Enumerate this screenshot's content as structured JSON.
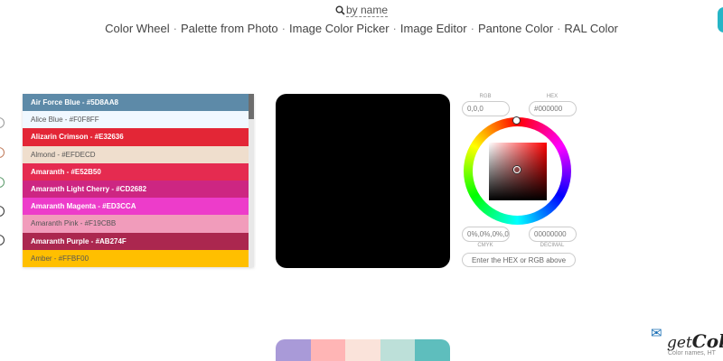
{
  "search": {
    "label": "by name"
  },
  "nav": [
    "Color Wheel",
    "Palette from Photo",
    "Image Color Picker",
    "Image Editor",
    "Pantone Color",
    "RAL Color"
  ],
  "color_list": [
    {
      "label": "Air Force Blue - #5D8AA8",
      "bg": "#5D8AA8",
      "fg": "#ffffff"
    },
    {
      "label": "Alice Blue - #F0F8FF",
      "bg": "#F0F8FF",
      "fg": "#555555"
    },
    {
      "label": "Alizarin Crimson - #E32636",
      "bg": "#E32636",
      "fg": "#ffffff"
    },
    {
      "label": "Almond - #EFDECD",
      "bg": "#EFDECD",
      "fg": "#555555"
    },
    {
      "label": "Amaranth - #E52B50",
      "bg": "#E52B50",
      "fg": "#ffffff"
    },
    {
      "label": "Amaranth Light Cherry - #CD2682",
      "bg": "#CD2682",
      "fg": "#ffffff"
    },
    {
      "label": "Amaranth Magenta - #ED3CCA",
      "bg": "#ED3CCA",
      "fg": "#ffffff"
    },
    {
      "label": "Amaranth Pink - #F19CBB",
      "bg": "#F19CBB",
      "fg": "#555555"
    },
    {
      "label": "Amaranth Purple - #AB274F",
      "bg": "#AB274F",
      "fg": "#ffffff"
    },
    {
      "label": "Amber - #FFBF00",
      "bg": "#FFBF00",
      "fg": "#555555"
    }
  ],
  "preview": {
    "color": "#000000"
  },
  "picker": {
    "rgb_label": "RGB",
    "hex_label": "HEX",
    "rgb_value": "0,0,0",
    "hex_value": "#000000",
    "cmyk_label": "CMYK",
    "decimal_label": "DECIMAL",
    "cmyk_value": "0%,0%,0%,0",
    "decimal_value": "00000000",
    "hint": "Enter the HEX or RGB above"
  },
  "palette": [
    "#A99AD8",
    "#FFB5B5",
    "#FAE3DA",
    "#BDE0D9",
    "#5EBEBD"
  ],
  "logo": {
    "get": "get",
    "col": "Col",
    "sub": "Color names, HT"
  },
  "icons": {
    "search": "magnifier-icon",
    "logo": "envelope-icon"
  }
}
